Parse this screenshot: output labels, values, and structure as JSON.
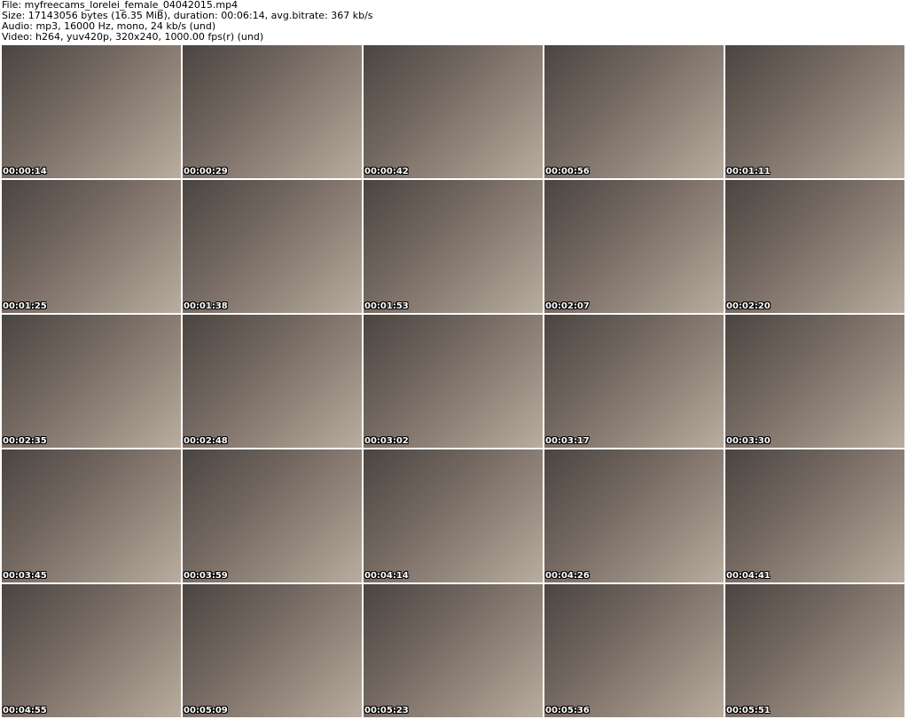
{
  "header": {
    "file": "File: myfreecams_lorelei_female_04042015.mp4",
    "size": "Size: 17143056 bytes (16.35 MiB), duration: 00:06:14, avg.bitrate: 367 kb/s",
    "audio": "Audio: mp3, 16000 Hz, mono, 24 kb/s (und)",
    "video": "Video: h264, yuv420p, 320x240, 1000.00 fps(r) (und)"
  },
  "frames": [
    "00:00:14",
    "00:00:29",
    "00:00:42",
    "00:00:56",
    "00:01:11",
    "00:01:25",
    "00:01:38",
    "00:01:53",
    "00:02:07",
    "00:02:20",
    "00:02:35",
    "00:02:48",
    "00:03:02",
    "00:03:17",
    "00:03:30",
    "00:03:45",
    "00:03:59",
    "00:04:14",
    "00:04:26",
    "00:04:41",
    "00:04:55",
    "00:05:09",
    "00:05:23",
    "00:05:36",
    "00:05:51"
  ]
}
